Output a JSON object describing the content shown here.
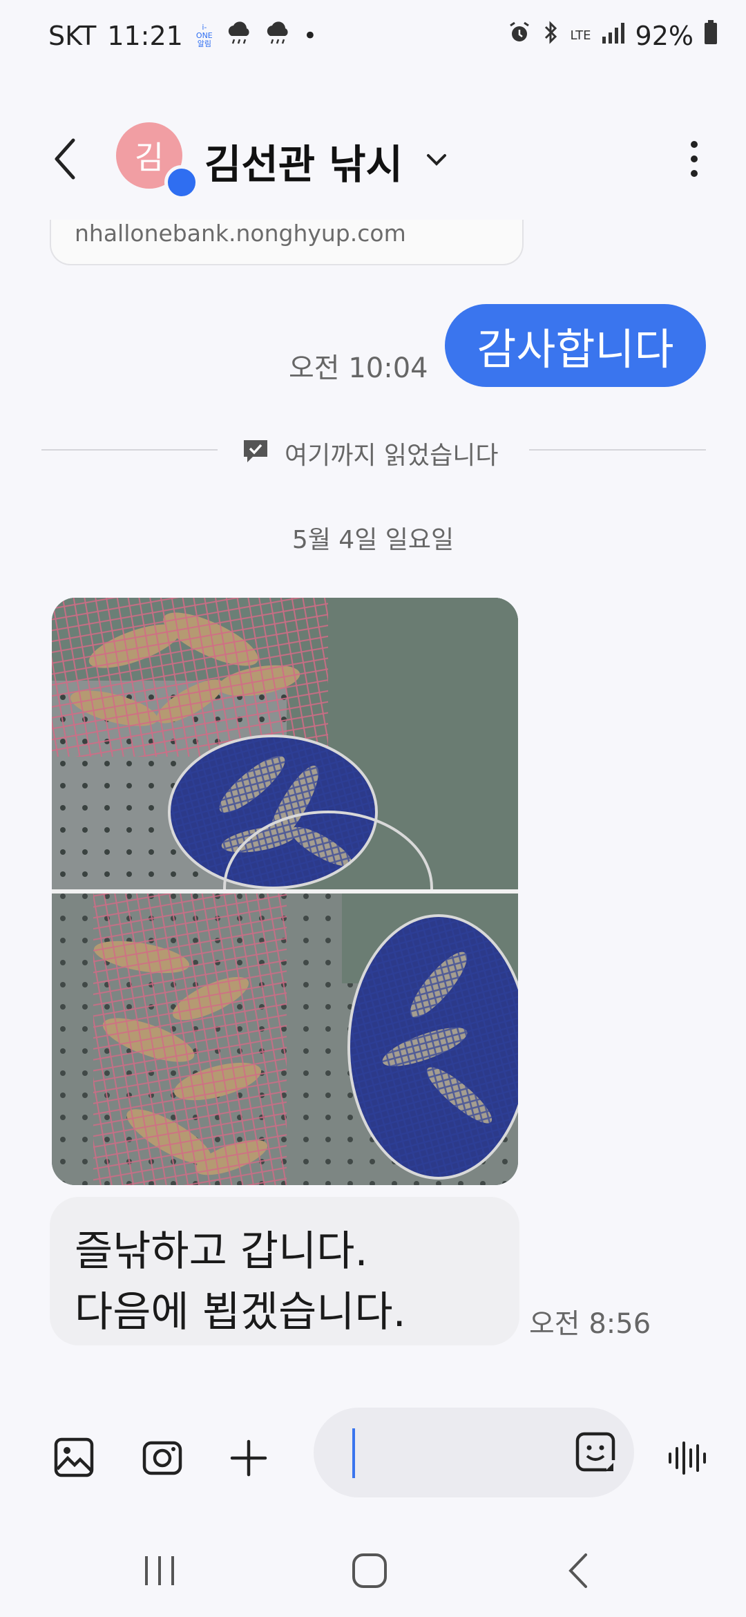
{
  "status_bar": {
    "carrier": "SKT",
    "time": "11:21",
    "badge": "i-ONE 알림",
    "dot": "•",
    "network": "LTE",
    "battery": "92%",
    "icons": [
      "weather-rain-icon",
      "weather-rain-icon",
      "alarm-icon",
      "bluetooth-icon",
      "signal-icon",
      "battery-icon"
    ]
  },
  "header": {
    "avatar_initial": "김",
    "contact_name": "김선관 낚시",
    "icons": [
      "back-icon",
      "chevron-down-icon",
      "more-vertical-icon"
    ]
  },
  "conversation": {
    "link_domain": "nhallonebank.nonghyup.com",
    "sent_message": "감사합니다",
    "sent_time": "오전 10:04",
    "read_marker": "여기까지 읽었습니다",
    "date_separator": "5월 4일 일요일",
    "photo_description_icon": "photo-fish-catch",
    "received_line_1": "즐낚하고 갑니다.",
    "received_line_2": "다음에 뵙겠습니다.",
    "received_time": "오전 8:56"
  },
  "composer": {
    "input_value": "",
    "icons": [
      "gallery-icon",
      "camera-icon",
      "add-icon",
      "sticker-icon",
      "voice-icon"
    ]
  },
  "nav_bar": {
    "icons": [
      "recents-icon",
      "home-icon",
      "back-nav-icon"
    ]
  },
  "colors": {
    "accent": "#3a75ee",
    "avatar_bg": "#f19ea3",
    "background": "#f7f7fb",
    "received_bubble": "#efeff2"
  }
}
